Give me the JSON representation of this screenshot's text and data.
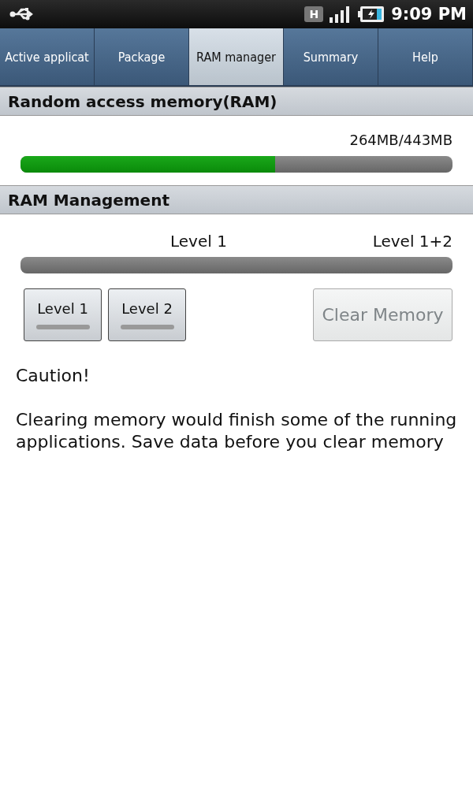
{
  "status_bar": {
    "time": "9:09 PM",
    "network_badge": "H"
  },
  "tabs": [
    {
      "label": "Active applicat",
      "selected": false
    },
    {
      "label": "Package",
      "selected": false
    },
    {
      "label": "RAM manager",
      "selected": true
    },
    {
      "label": "Summary",
      "selected": false
    },
    {
      "label": "Help",
      "selected": false
    }
  ],
  "ram_section": {
    "title": "Random access memory(RAM)",
    "reading": "264MB/443MB",
    "level": 0.59
  },
  "management_section": {
    "title": "RAM Management",
    "level_labels": [
      "Level 1",
      "Level 1+2"
    ],
    "level": 0,
    "toggle_buttons": [
      {
        "label": "Level 1",
        "on": false
      },
      {
        "label": "Level 2",
        "on": false
      }
    ],
    "clear_button": {
      "label": "Clear Memory",
      "disabled": true
    }
  },
  "caution": {
    "title": "Caution!",
    "message": "Clearing memory would finish some of the running applications. Save data before you clear memory"
  }
}
